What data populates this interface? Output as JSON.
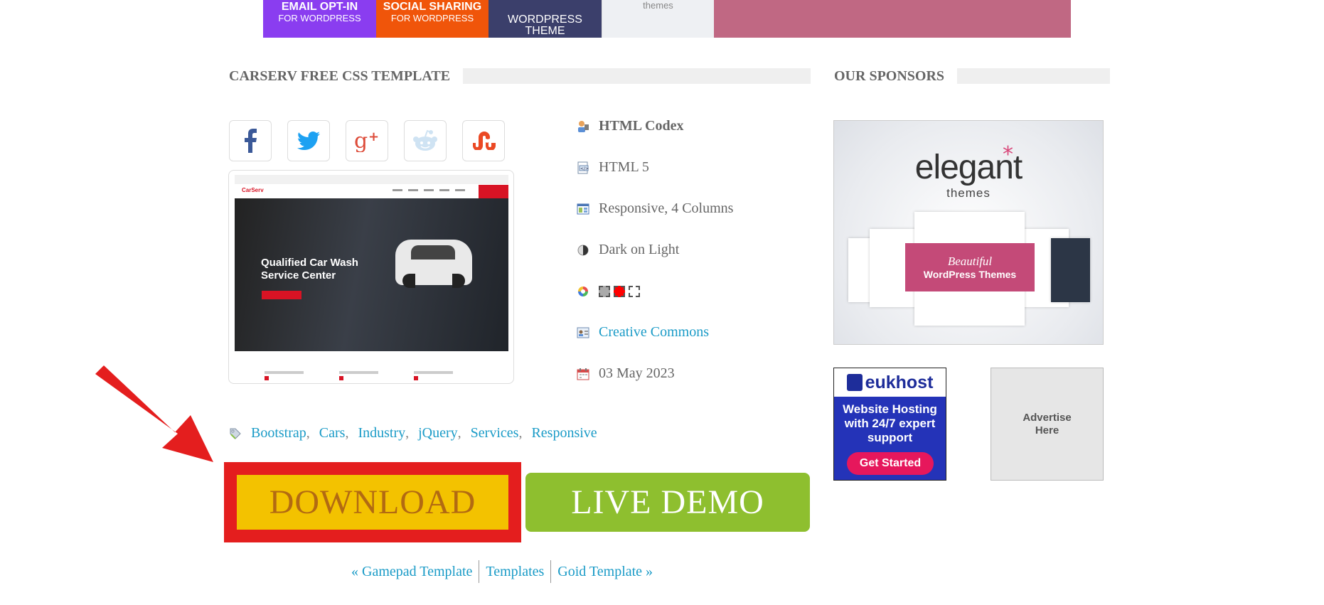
{
  "banner": {
    "ad1": {
      "line1": "EMAIL OPT-IN",
      "line2": "FOR WORDPRESS",
      "color": "#8a3df0"
    },
    "ad2": {
      "line1": "SOCIAL SHARING",
      "line2": "FOR WORDPRESS",
      "color": "#f0550a"
    },
    "ad3": {
      "line1": "WORDPRESS THEME",
      "color": "#3b3f6b"
    },
    "ad4": {
      "line1": "themes"
    },
    "ad5": {
      "color": "#c06883"
    }
  },
  "template": {
    "heading": "CARSERV FREE CSS TEMPLATE",
    "share_icons": [
      "facebook-icon",
      "twitter-icon",
      "google-plus-icon",
      "reddit-icon",
      "stumbleupon-icon"
    ],
    "preview": {
      "logo": "CarServ",
      "hero_title_line1": "Qualified Car Wash",
      "hero_title_line2": "Service Center"
    },
    "info": {
      "author": "HTML Codex",
      "html_version": "HTML 5",
      "layout": "Responsive, 4 Columns",
      "scheme": "Dark on Light",
      "colors": [
        "#aaaaaa",
        "#ff0000",
        "#ffffff"
      ],
      "license": "Creative Commons",
      "date": "03 May 2023"
    },
    "tags": [
      "Bootstrap",
      "Cars",
      "Industry",
      "jQuery",
      "Services",
      "Responsive"
    ],
    "tag_separator": ",",
    "download_label": "DOWNLOAD",
    "demo_label": "LIVE DEMO",
    "pager": {
      "prev": "« Gamepad Template",
      "index": "Templates",
      "next": "Goid Template »"
    }
  },
  "sponsors": {
    "heading": "OUR SPONSORS",
    "elegant": {
      "logo": "elegant",
      "sub": "themes",
      "ribbon_line1": "Beautiful",
      "ribbon_line2": "WordPress Themes"
    },
    "eukhost": {
      "logo": "eukhost",
      "text_line1": "Website Hosting",
      "text_line2": "with 24/7 expert",
      "text_line3": "support",
      "cta": "Get Started"
    },
    "advertise": {
      "line1": "Advertise",
      "line2": "Here"
    }
  },
  "colors": {
    "link": "#1a9bc7",
    "download_bg": "#f3c200",
    "download_text": "#b26a12",
    "highlight": "#e41e1e",
    "demo_bg": "#8ebf2f"
  }
}
